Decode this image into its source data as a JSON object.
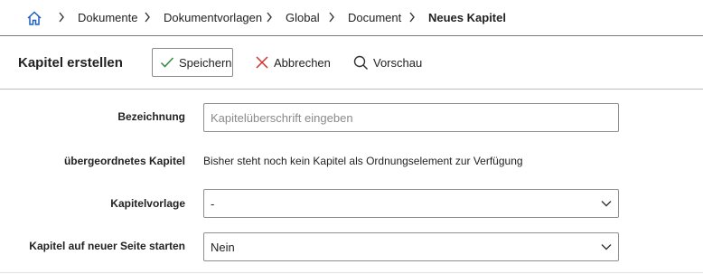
{
  "breadcrumb": {
    "items": [
      {
        "label": "Dokumente"
      },
      {
        "label": "Dokumentvorlagen"
      },
      {
        "label": "Global"
      },
      {
        "label": "Document"
      }
    ],
    "current": "Neues Kapitel"
  },
  "toolbar": {
    "title": "Kapitel erstellen",
    "save_label": "Speichern",
    "cancel_label": "Abbrechen",
    "preview_label": "Vorschau"
  },
  "form": {
    "bezeichnung": {
      "label": "Bezeichnung",
      "value": "",
      "placeholder": "Kapitelüberschrift eingeben"
    },
    "parent": {
      "label": "übergeordnetes Kapitel",
      "text": "Bisher steht noch kein Kapitel als Ordnungselement zur Verfügung"
    },
    "template": {
      "label": "Kapitelvorlage",
      "value": "-"
    },
    "new_page": {
      "label": "Kapitel auf neuer Seite starten",
      "value": "Nein"
    }
  },
  "colors": {
    "accent_blue": "#1f5fbf",
    "save_green": "#2e8b3a",
    "cancel_red": "#d0312d"
  }
}
